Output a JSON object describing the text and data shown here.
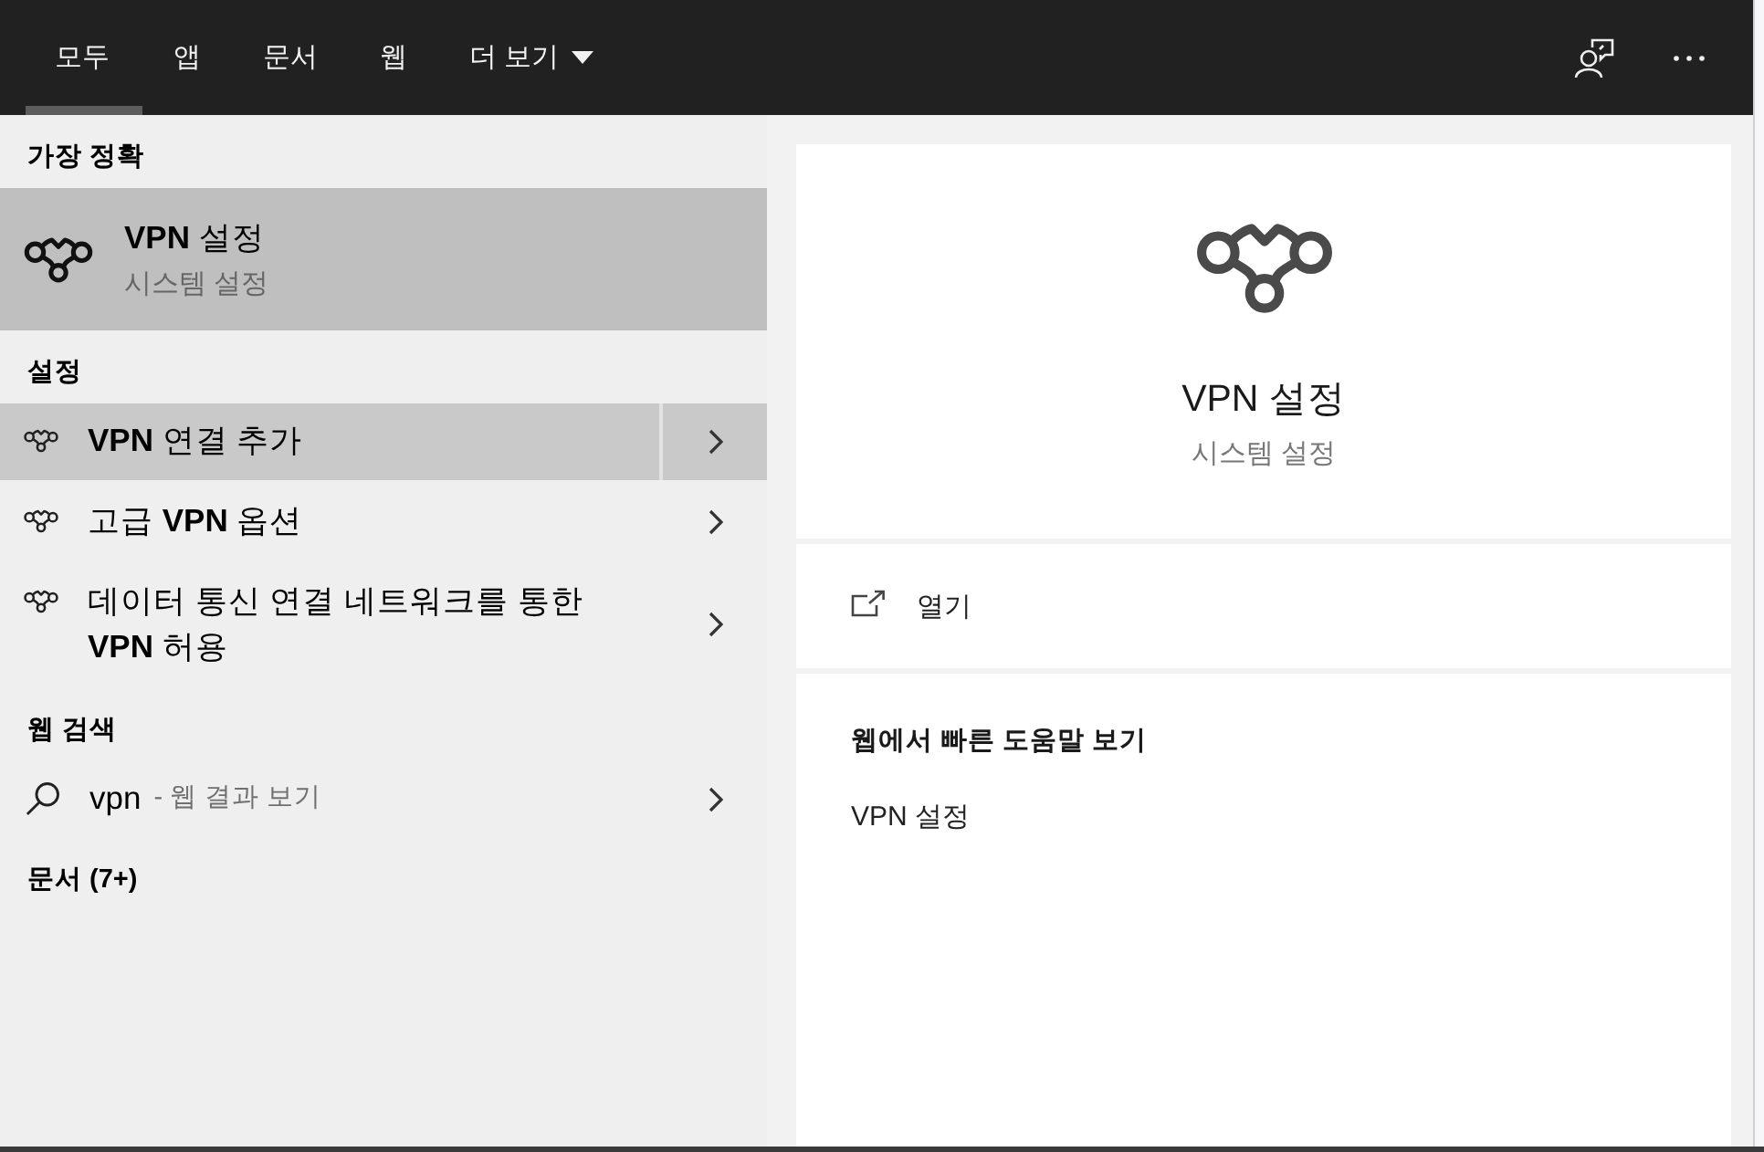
{
  "tabs": [
    {
      "label": "모두",
      "kind": "filter",
      "selected": true
    },
    {
      "label": "앱",
      "kind": "filter",
      "selected": false
    },
    {
      "label": "문서",
      "kind": "filter",
      "selected": false
    },
    {
      "label": "웹",
      "kind": "filter",
      "selected": false
    },
    {
      "label": "더 보기",
      "kind": "dropdown",
      "selected": false
    }
  ],
  "results": [
    {
      "heading": "가장 정확",
      "items": [
        {
          "kind": "best_match",
          "title": "**VPN** 설정",
          "subtitle": "시스템 설정",
          "selected": true,
          "hovered": false
        }
      ]
    },
    {
      "heading": "설정",
      "items": [
        {
          "kind": "setting",
          "title": "**VPN** 연결 추가",
          "selected": false,
          "hovered": true
        },
        {
          "kind": "setting",
          "title": "고급 **VPN** 옵션",
          "selected": false,
          "hovered": false
        },
        {
          "kind": "setting",
          "title": "데이터 통신 연결 네트워크를 통한 **VPN** 허용",
          "selected": false,
          "hovered": false
        }
      ]
    },
    {
      "heading": "웹 검색",
      "items": [
        {
          "kind": "web",
          "title": "vpn",
          "subtitle": "- 웹 결과 보기",
          "selected": false,
          "hovered": false
        }
      ]
    },
    {
      "heading": "문서 (7+)"
    }
  ],
  "preview": {
    "title": "VPN 설정",
    "subtitle": "시스템 설정",
    "actions": [
      {
        "label": "열기"
      }
    ],
    "help_heading": "웹에서 빠른 도움말 보기",
    "help_links": [
      "VPN 설정"
    ]
  }
}
